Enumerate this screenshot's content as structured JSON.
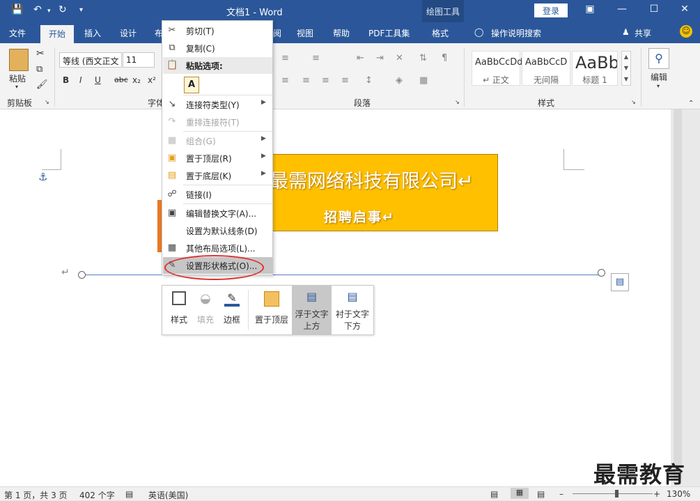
{
  "titlebar": {
    "doc_title": "文档1  -  Word",
    "context_tab": "绘图工具",
    "login": "登录",
    "qa_icons": [
      "save-icon",
      "undo-icon",
      "redo-icon",
      "customize-icon"
    ]
  },
  "tabs": {
    "file": "文件",
    "home": "开始",
    "insert": "插入",
    "design": "设计",
    "layout": "布",
    "review": "阅",
    "view": "视图",
    "help": "帮助",
    "pdf": "PDF工具集",
    "format": "格式",
    "tellme": "操作说明搜索",
    "share": "共享"
  },
  "ribbon": {
    "clipboard": {
      "paste": "粘贴",
      "label": "剪贴板"
    },
    "font": {
      "name": "等线 (西文正文",
      "size": "11",
      "label": "字体",
      "bold": "B",
      "italic": "I",
      "underline": "U",
      "strike": "abc",
      "sub": "x₂",
      "sup": "x²"
    },
    "paragraph": {
      "label": "段落"
    },
    "styles": {
      "label": "样式",
      "items": [
        {
          "sample": "AaBbCcDd",
          "name": "↵ 正文"
        },
        {
          "sample": "AaBbCcD",
          "name": "无间隔"
        },
        {
          "sample": "AaBb",
          "name": "标题 1"
        }
      ]
    },
    "editing": {
      "label": "编辑"
    }
  },
  "document": {
    "box_title": "最需网络科技有限公司↵",
    "box_subtitle": "招聘启事↵",
    "para_mark": "↵"
  },
  "context_menu": {
    "items": [
      {
        "label": "剪切(T)",
        "icon": "scissors-icon",
        "disabled": false
      },
      {
        "label": "复制(C)",
        "icon": "copy-icon",
        "disabled": false
      },
      {
        "label": "粘贴选项:",
        "icon": "paste-icon",
        "disabled": false
      },
      {
        "label": "连接符类型(Y)",
        "icon": "connector-icon",
        "disabled": false,
        "submenu": true
      },
      {
        "label": "重排连接符(T)",
        "icon": "reroute-icon",
        "disabled": true
      },
      {
        "label": "组合(G)",
        "icon": "group-icon",
        "disabled": true,
        "submenu": true
      },
      {
        "label": "置于顶层(R)",
        "icon": "bring-front-icon",
        "disabled": false,
        "submenu": true
      },
      {
        "label": "置于底层(K)",
        "icon": "send-back-icon",
        "disabled": false,
        "submenu": true
      },
      {
        "label": "链接(I)",
        "icon": "link-icon",
        "disabled": false
      },
      {
        "label": "编辑替换文字(A)...",
        "icon": "alt-text-icon",
        "disabled": false
      },
      {
        "label": "设置为默认线条(D)",
        "icon": "",
        "disabled": false
      },
      {
        "label": "其他布局选项(L)...",
        "icon": "layout-icon",
        "disabled": false
      },
      {
        "label": "设置形状格式(O)...",
        "icon": "format-shape-icon",
        "disabled": false
      }
    ]
  },
  "mini_toolbar": {
    "style": "样式",
    "fill": "填充",
    "border": "边框",
    "bring_front": "置于顶层",
    "in_front_1": "浮于文字",
    "in_front_2": "上方",
    "behind_1": "衬于文字",
    "behind_2": "下方"
  },
  "status": {
    "page": "第 1 页，共 3 页",
    "words": "402 个字",
    "lang": "英语(美国)",
    "zoom": "130%"
  },
  "watermark": "最需教育",
  "colors": {
    "accent": "#2b579a",
    "box": "#ffc000",
    "highlight_circle": "#e03030"
  }
}
